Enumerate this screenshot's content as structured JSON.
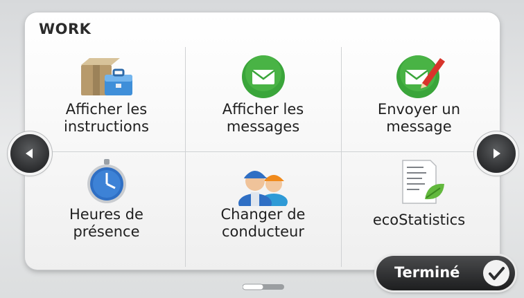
{
  "section": {
    "title": "WORK"
  },
  "tiles": [
    {
      "id": "afficher-instructions",
      "icon": "package-toolbox-icon",
      "label_line1": "Afficher les",
      "label_line2": "instructions"
    },
    {
      "id": "afficher-messages",
      "icon": "envelope-icon",
      "label_line1": "Afficher les",
      "label_line2": "messages"
    },
    {
      "id": "envoyer-message",
      "icon": "envelope-pencil-icon",
      "label_line1": "Envoyer un",
      "label_line2": "message"
    },
    {
      "id": "heures-presence",
      "icon": "stopwatch-icon",
      "label_line1": "Heures de",
      "label_line2": "présence"
    },
    {
      "id": "changer-conducteur",
      "icon": "drivers-icon",
      "label_line1": "Changer de",
      "label_line2": "conducteur"
    },
    {
      "id": "ecostatistics",
      "icon": "eco-report-icon",
      "label_line1": "ecoStatistics",
      "label_line2": ""
    }
  ],
  "navigation": {
    "prev": "chevron-left-icon",
    "next": "chevron-right-icon"
  },
  "footer": {
    "done_label": "Terminé",
    "done_icon": "checkmark-icon"
  },
  "pager": {
    "pages": 2,
    "current": 1
  },
  "colors": {
    "green": "#3aa53a",
    "blue": "#2f6fc4",
    "dark": "#1d1e1f"
  }
}
